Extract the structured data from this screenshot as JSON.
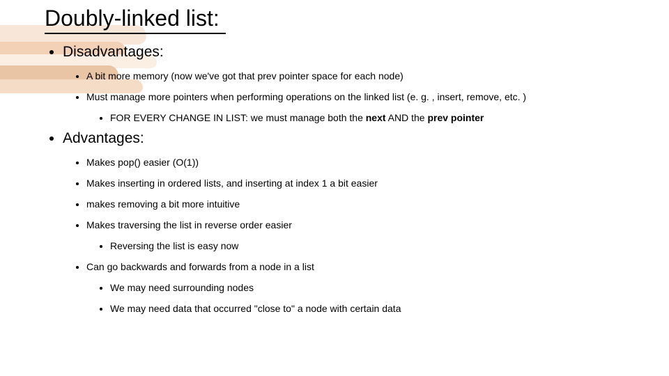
{
  "title": "Doubly-linked list:",
  "disadvantages": {
    "heading": "Disadvantages:",
    "items": {
      "memory": "A bit more memory (now we've got that prev pointer space for each node)",
      "pointers": "Must manage more pointers when performing operations on the linked list (e. g. , insert, remove, etc. )",
      "every_change_prefix": "FOR  EVERY CHANGE IN LIST: we must manage both the ",
      "every_change_bold1": "next",
      "every_change_mid": " AND the ",
      "every_change_bold2": "prev pointer"
    }
  },
  "advantages": {
    "heading": "Advantages:",
    "items": {
      "pop": "Makes pop() easier (O(1))",
      "insert": "Makes inserting in ordered lists, and inserting at index 1 a bit easier",
      "remove": "makes removing a bit more intuitive",
      "traverse": "Makes traversing the list in reverse order easier",
      "reverse": "Reversing the list is easy now",
      "bidir": "Can go backwards and forwards from a node in a list",
      "surrounding": "We may need surrounding nodes",
      "close_to": "We may need data that occurred \"close to\" a node with certain data"
    }
  }
}
